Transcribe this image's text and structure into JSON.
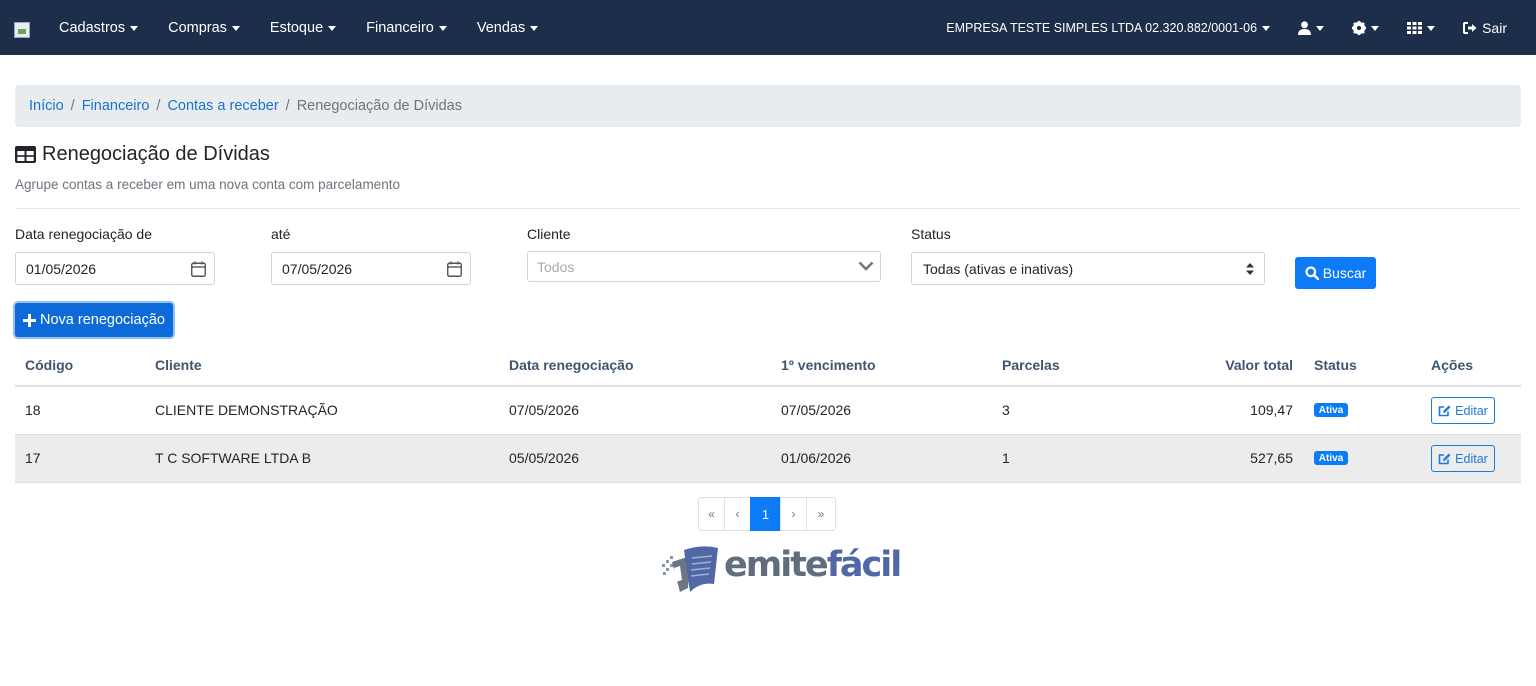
{
  "navbar": {
    "menu": [
      "Cadastros",
      "Compras",
      "Estoque",
      "Financeiro",
      "Vendas"
    ],
    "company": "EMPRESA TESTE SIMPLES LTDA 02.320.882/0001-06",
    "logout": "Sair"
  },
  "breadcrumb": {
    "items": [
      "Início",
      "Financeiro",
      "Contas a receber"
    ],
    "active": "Renegociação de Dívidas",
    "separator": "/"
  },
  "page": {
    "title": "Renegociação de Dívidas",
    "subtitle": "Agrupe contas a receber em uma nova conta com parcelamento"
  },
  "filters": {
    "date_from_label": "Data renegociação de",
    "date_from_value": "01/05/2026",
    "date_to_label": "até",
    "date_to_value": "07/05/2026",
    "client_label": "Cliente",
    "client_placeholder": "Todos",
    "status_label": "Status",
    "status_value": "Todas (ativas e inativas)",
    "search_button": "Buscar"
  },
  "new_button": "Nova renegociação",
  "table": {
    "headers": [
      "Código",
      "Cliente",
      "Data renegociação",
      "1º vencimento",
      "Parcelas",
      "Valor total",
      "Status",
      "Ações"
    ],
    "rows": [
      {
        "codigo": "18",
        "cliente": "CLIENTE DEMONSTRAÇÃO",
        "data": "07/05/2026",
        "vencimento": "07/05/2026",
        "parcelas": "3",
        "valor": "109,47",
        "status": "Ativa",
        "acao": "Editar"
      },
      {
        "codigo": "17",
        "cliente": "T C SOFTWARE LTDA B",
        "data": "05/05/2026",
        "vencimento": "01/06/2026",
        "parcelas": "1",
        "valor": "527,65",
        "status": "Ativa",
        "acao": "Editar"
      }
    ]
  },
  "pagination": {
    "first": "«",
    "prev": "‹",
    "current": "1",
    "next": "›",
    "last": "»"
  },
  "logo": {
    "part1": "emite",
    "part2": "fácil"
  },
  "colors": {
    "navbar": "#1c2e4a",
    "primary": "#0d7bf5",
    "link": "#1a73c9"
  },
  "icons": [
    "user-icon",
    "gear-icon",
    "grid-icon",
    "sign-out-icon",
    "table-icon",
    "calendar-icon",
    "search-icon",
    "plus-icon",
    "edit-icon"
  ]
}
